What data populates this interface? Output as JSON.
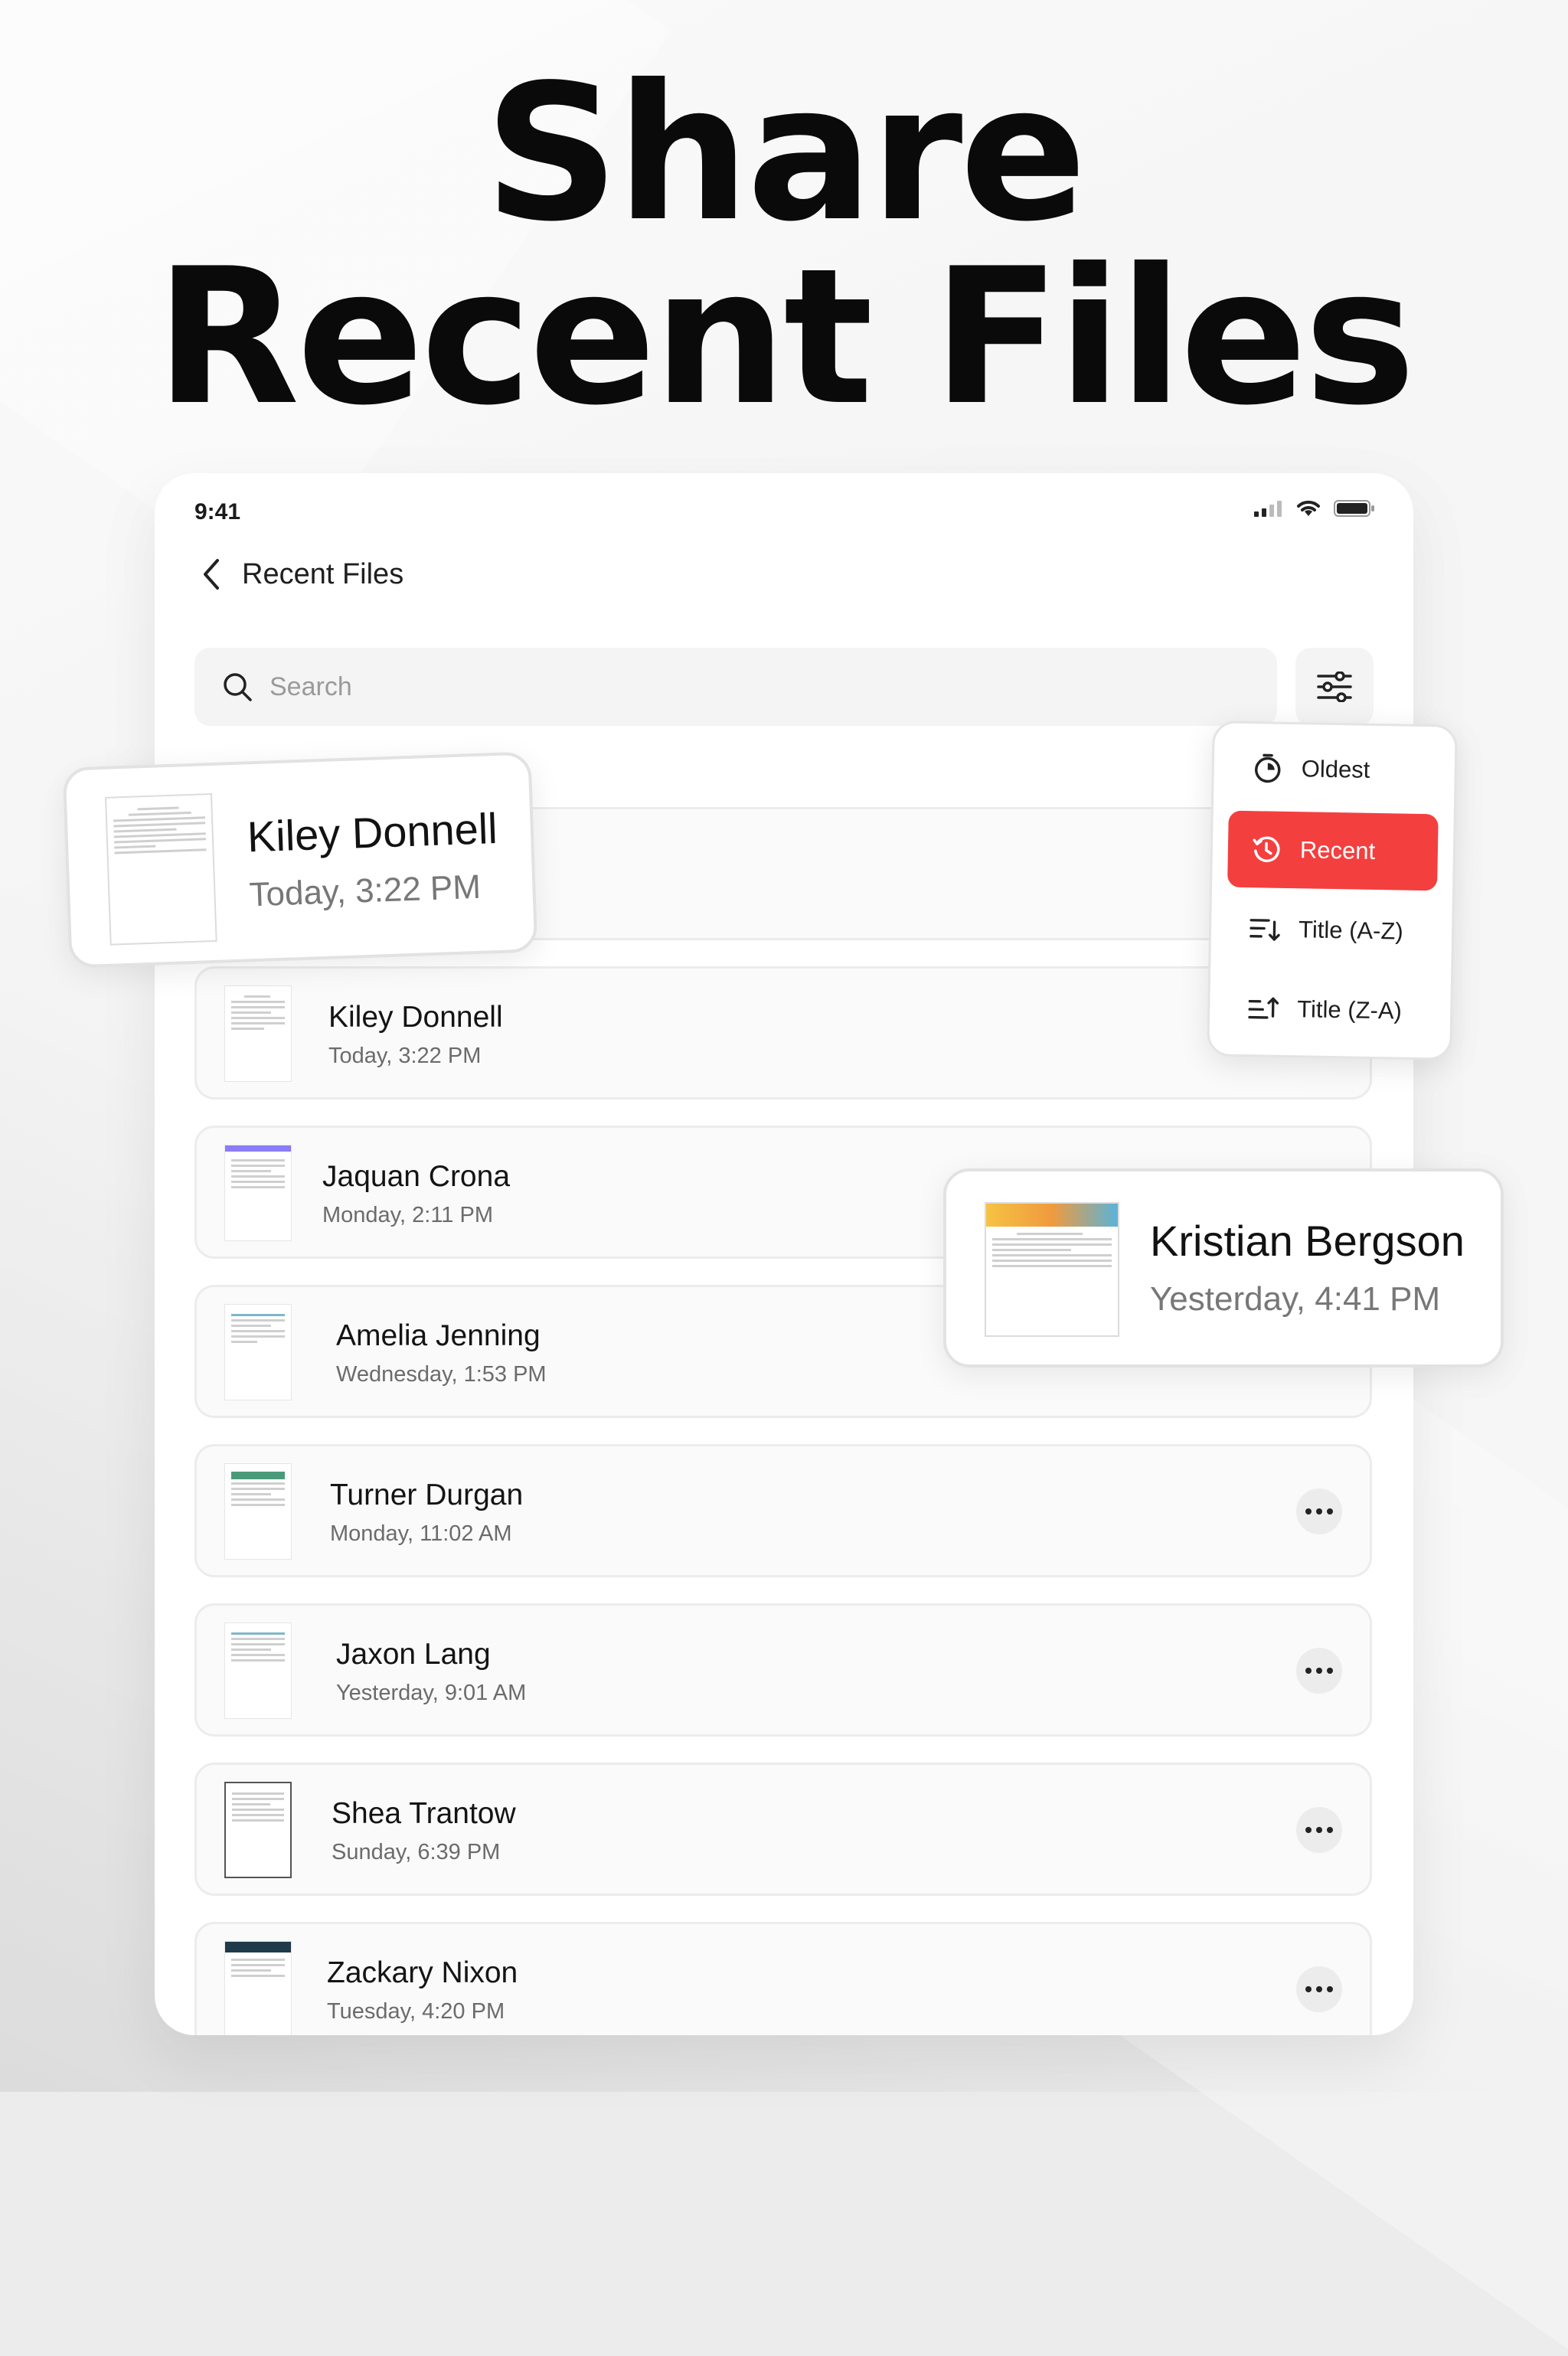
{
  "headline": {
    "line1": "Share",
    "line2": "Recent Files"
  },
  "status_bar": {
    "time": "9:41"
  },
  "nav": {
    "title": "Recent Files"
  },
  "search": {
    "placeholder": "Search"
  },
  "sort_menu": {
    "items": [
      {
        "label": "Oldest",
        "icon": "stopwatch-icon",
        "active": false
      },
      {
        "label": "Recent",
        "icon": "history-icon",
        "active": true
      },
      {
        "label": "Title (A-Z)",
        "icon": "sort-ascending-icon",
        "active": false
      },
      {
        "label": "Title (Z-A)",
        "icon": "sort-descending-icon",
        "active": false
      }
    ]
  },
  "highlight_cards": [
    {
      "name": "Kiley Donnell",
      "date": "Today, 3:22 PM"
    },
    {
      "name": "Kristian Bergson",
      "date": "Yesterday, 4:41 PM"
    }
  ],
  "files": [
    {
      "name": "Kiley Donnell",
      "date": "Today, 3:22 PM"
    },
    {
      "name": "Jaquan Crona",
      "date": "Monday, 2:11 PM"
    },
    {
      "name": "Amelia Jenning",
      "date": "Wednesday, 1:53 PM"
    },
    {
      "name": "Turner Durgan",
      "date": "Monday, 11:02 AM"
    },
    {
      "name": "Jaxon Lang",
      "date": "Yesterday, 9:01 AM"
    },
    {
      "name": "Shea Trantow",
      "date": "Sunday, 6:39 PM"
    },
    {
      "name": "Zackary Nixon",
      "date": "Tuesday, 4:20 PM"
    }
  ],
  "colors": {
    "accent": "#f43f3f",
    "background": "#ececec",
    "card": "#ffffff"
  }
}
